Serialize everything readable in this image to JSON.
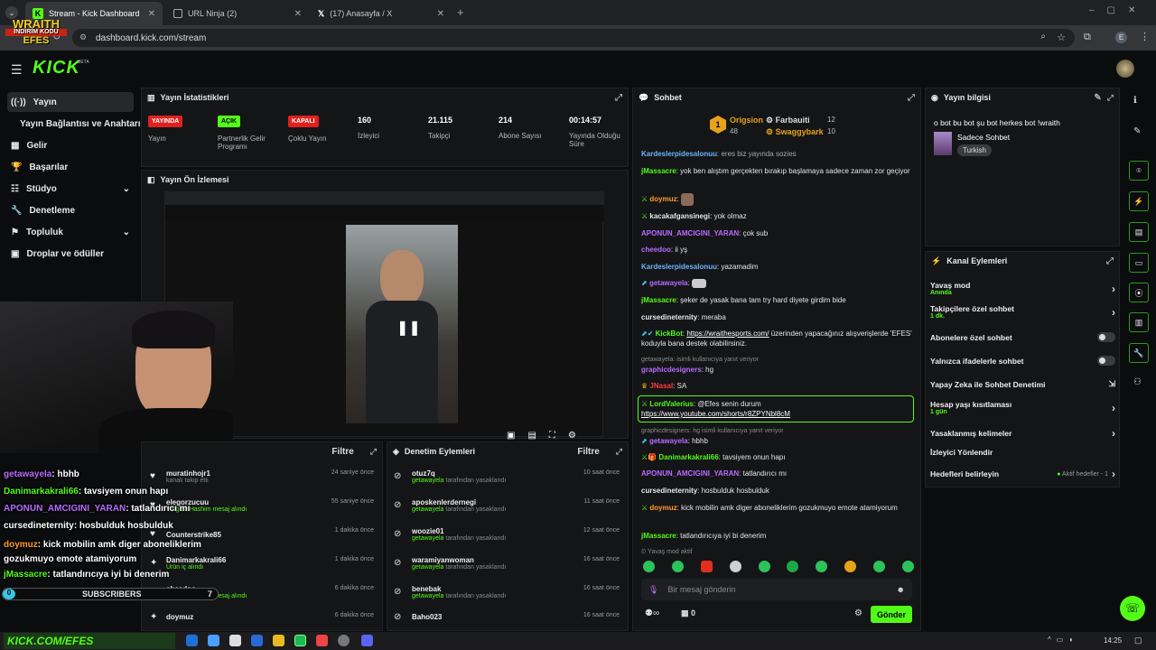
{
  "browser": {
    "tabs": [
      {
        "label": "Stream - Kick Dashboard"
      },
      {
        "label": "URL Ninja (2)"
      },
      {
        "label": "(17) Anasayfa / X"
      }
    ],
    "url": "dashboard.kick.com/stream",
    "profile_initial": "E"
  },
  "brand": {
    "logo": "KICK",
    "beta": "BETA",
    "accent": "#53fc18"
  },
  "overlay_brand": {
    "line1": "WRAITH",
    "line2": "İNDİRİM KODU",
    "line3": "EFES"
  },
  "sidebar": {
    "items": [
      {
        "label": "Yayın"
      },
      {
        "label": "Yayın Bağlantısı ve Anahtarı"
      },
      {
        "label": "Gelir"
      },
      {
        "label": "Başarılar"
      },
      {
        "label": "Stüdyo"
      },
      {
        "label": "Denetleme"
      },
      {
        "label": "Topluluk"
      },
      {
        "label": "Droplar ve ödüller"
      }
    ]
  },
  "stats": {
    "title": "Yayın İstatistikleri",
    "items": [
      {
        "value": "YAYINDA",
        "label": "Yayın"
      },
      {
        "value": "AÇIK",
        "label": "Partnerlik Gelir Programı"
      },
      {
        "value": "KAPALI",
        "label": "Çoklu Yayın"
      },
      {
        "value": "160",
        "label": "İzleyici"
      },
      {
        "value": "21.115",
        "label": "Takipçi"
      },
      {
        "value": "214",
        "label": "Abone Sayısı"
      },
      {
        "value": "00:14:57",
        "label": "Yayında Olduğu Süre"
      }
    ]
  },
  "preview": {
    "title": "Yayın Ön İzlemesi"
  },
  "activity": {
    "filter": "Filtre",
    "rows": [
      {
        "user": "muratinhojr1",
        "sub": "kanalı takip etti",
        "time": "24 saniye önce"
      },
      {
        "user": "elegorzucuu",
        "sub": "Vurgulu Hashim mesaj alındı",
        "time": "55 saniye önce"
      },
      {
        "user": "Counterstrike85",
        "sub": "",
        "time": "1 dakika önce"
      },
      {
        "user": "Danimarkakrali66",
        "sub": "Ürün iç alındı",
        "time": "1 dakika önce"
      },
      {
        "user": "cheedoo",
        "sub": "Vurgulu Hashim mesaj alındı",
        "time": "6 dakika önce"
      },
      {
        "user": "doymuz",
        "sub": "",
        "time": "6 dakika önce"
      }
    ]
  },
  "moderation": {
    "title": "Denetim Eylemleri",
    "filter": "Filtre",
    "rows": [
      {
        "user": "otuz7q",
        "by": "getawayela",
        "action": "tarafından yasaklandı",
        "time": "10 saat önce"
      },
      {
        "user": "aposkenlerdernegi",
        "by": "getawayela",
        "action": "tarafından yasaklandı",
        "time": "11 saat önce"
      },
      {
        "user": "woozie01",
        "by": "getawayela",
        "action": "tarafından yasaklandı",
        "time": "12 saat önce"
      },
      {
        "user": "waramiyanwoman",
        "by": "getawayela",
        "action": "tarafından yasaklandı",
        "time": "16 saat önce"
      },
      {
        "user": "benebak",
        "by": "getawayela",
        "action": "tarafından yasaklandı",
        "time": "16 saat önce"
      },
      {
        "user": "Baho023",
        "by": "",
        "action": "",
        "time": "16 saat önce"
      }
    ]
  },
  "chat": {
    "title": "Sohbet",
    "leaders": [
      {
        "name": "Origsion",
        "count": "48"
      },
      {
        "name": "Farbauiti",
        "count": "12"
      },
      {
        "name": "Swaggybark",
        "count": "10"
      }
    ],
    "messages": [
      {
        "user": "Kardeslerpidesalonuu",
        "text": "eres biz yayında sozies"
      },
      {
        "user": "jMassacre",
        "text": "yok ben alıştım gerçekten bırakıp başlamaya sadece zaman zor geçiyor"
      },
      {
        "user": "doymuz",
        "text": ""
      },
      {
        "user": "kacakafgansinegi",
        "text": "yok olmaz"
      },
      {
        "user": "APONUN_AMCIGINI_YARAN",
        "text": "çok sub"
      },
      {
        "user": "cheedoo",
        "text": "ii yş"
      },
      {
        "user": "Kardeslerpidesalonuu",
        "text": "yazamadim"
      },
      {
        "user": "getawayela",
        "text": ""
      },
      {
        "user": "jMassacre",
        "text": "şeker de yasak bana tam try hard diyete girdim bide"
      },
      {
        "user": "cursedineternity",
        "text": "meraba"
      },
      {
        "user": "KickBot",
        "link": "https://wraithesports.com/",
        "text": "üzerinden yapacağınız alışverişlerde 'EFES' koduyla bana destek olabilirsiniz."
      },
      {
        "user": "graphicdesigners",
        "reply": "getawayela: isimli kullanıcıya yanıt veriyor",
        "text": "hg"
      },
      {
        "user": "JNasal",
        "text": "SA"
      },
      {
        "user": "LordValerius",
        "text": "@Efes senin durum",
        "link": "https://www.youtube.com/shorts/r8ZPYNbl8cM"
      },
      {
        "user": "getawayela",
        "reply": "graphicdesigners: hg isimli kullanıcıya yanıt veriyor",
        "text": "hbhb"
      },
      {
        "user": "Danimarkakrali66",
        "text": "tavsiyem onun hapı"
      },
      {
        "user": "APONUN_AMCIGINI_YARAN",
        "text": "tatlandırıcı mı"
      },
      {
        "user": "cursedineternity",
        "text": "hosbulduk hosbulduk"
      },
      {
        "user": "doymuz",
        "text": "kick mobilin amk diger aboneliklerim gozukmuyo emote atamiyorum"
      },
      {
        "user": "jMassacre",
        "text": "tatlandırıcıya iyi bi denerim"
      }
    ],
    "slow_mode_note": "Yavaş mod aktif",
    "placeholder": "Bir mesaj gönderin",
    "send": "Gönder",
    "infinity_count": "",
    "gift_count": "0"
  },
  "stream_info": {
    "title": "Yayın bilgisi",
    "stream_title": "o bot bu bot şu bot herkes bot !wraith",
    "category": "Sadece Sohbet",
    "language": "Turkish"
  },
  "channel_actions": {
    "title": "Kanal Eylemleri",
    "items": [
      {
        "label": "Yavaş mod",
        "sub": "Anında"
      },
      {
        "label": "Takipçilere özel sohbet",
        "sub": "1 dk."
      },
      {
        "label": "Abonelere özel sohbet",
        "sub": ""
      },
      {
        "label": "Yalnızca ifadelerle sohbet",
        "sub": ""
      },
      {
        "label": "Yapay Zeka ile Sohbet Denetimi",
        "sub": ""
      },
      {
        "label": "Hesap yaşı kısıtlaması",
        "sub": "1 gün"
      },
      {
        "label": "Yasaklanmış kelimeler",
        "sub": ""
      },
      {
        "label": "İzleyici Yönlendir",
        "sub": ""
      },
      {
        "label": "Hedefleri belirleyin",
        "sub": "Aktif hedefler - 1"
      }
    ]
  },
  "overlay_chat": [
    {
      "user": "getawayela",
      "text": ": hbhb"
    },
    {
      "user": "Danimarkakrali66",
      "text": ": tavsiyem onun hapı"
    },
    {
      "user": "APONUN_AMCIGINI_YARAN",
      "text": ": tatlandırıcı mı"
    },
    {
      "user": "cursedineternity",
      "text": ": hosbulduk hosbulduk"
    },
    {
      "user": "doymuz",
      "text": ": kick mobilin amk diger aboneliklerim gozukmuyo emote atamiyorum"
    },
    {
      "user": "jMassacre",
      "text": ": tatlandırıcıya iyi bi denerim"
    }
  ],
  "subscribers_bar": {
    "label": "SUBSCRIBERS",
    "left": "0",
    "right": "7"
  },
  "taskbar": {
    "time": "14:25"
  }
}
